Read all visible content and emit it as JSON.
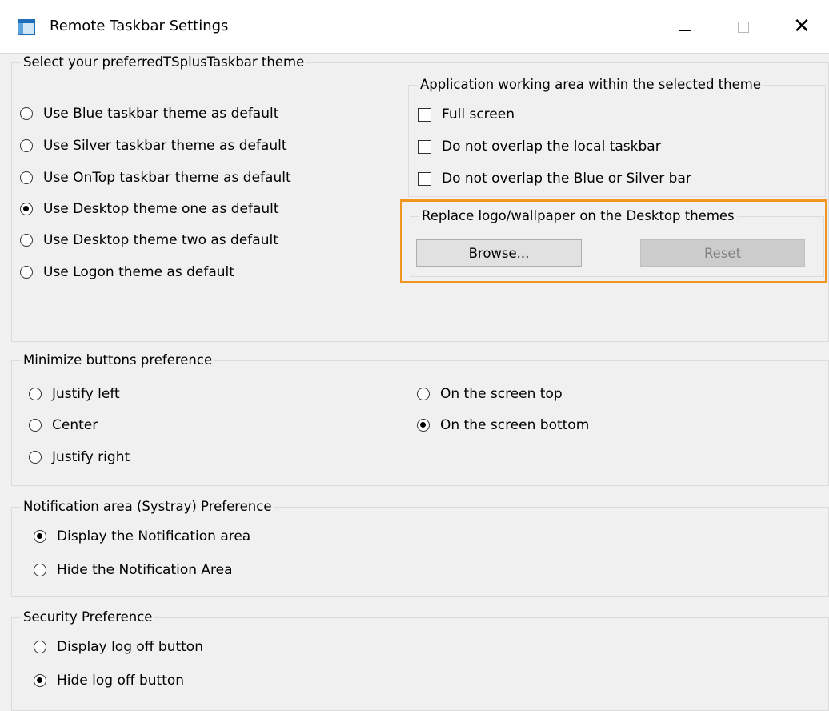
{
  "window": {
    "title": "Remote Taskbar Settings",
    "minimize_icon": "minimize-icon",
    "maximize_icon": "maximize-icon",
    "close_glyph": "✕"
  },
  "theme_group": {
    "legend": "Select your preferredTSplusTaskbar theme",
    "options": [
      {
        "label": "Use Blue taskbar theme as default",
        "checked": false
      },
      {
        "label": "Use Silver taskbar theme as default",
        "checked": false
      },
      {
        "label": "Use OnTop taskbar theme as default",
        "checked": false
      },
      {
        "label": "Use Desktop theme one as default",
        "checked": true
      },
      {
        "label": "Use Desktop theme two as default",
        "checked": false
      },
      {
        "label": "Use Logon theme as default",
        "checked": false
      }
    ]
  },
  "working_area": {
    "legend": "Application working area within the selected theme",
    "options": [
      {
        "label": "Full screen",
        "checked": false
      },
      {
        "label": "Do not overlap the local taskbar",
        "checked": false
      },
      {
        "label": "Do not overlap the Blue or Silver bar",
        "checked": false
      }
    ]
  },
  "replace_logo": {
    "legend": "Replace logo/wallpaper on the Desktop themes",
    "browse_label": "Browse...",
    "reset_label": "Reset",
    "reset_enabled": false,
    "highlight_color": "#f0961e"
  },
  "minimize_group": {
    "legend": "Minimize buttons preference",
    "justify_options": [
      {
        "label": "Justify left",
        "checked": false
      },
      {
        "label": "Center",
        "checked": false
      },
      {
        "label": "Justify right",
        "checked": false
      }
    ],
    "position_options": [
      {
        "label": "On the screen top",
        "checked": false
      },
      {
        "label": "On the screen bottom",
        "checked": true
      }
    ]
  },
  "notification_group": {
    "legend": "Notification area (Systray) Preference",
    "options": [
      {
        "label": "Display the Notification area",
        "checked": true
      },
      {
        "label": "Hide the Notification Area",
        "checked": false
      }
    ]
  },
  "security_group": {
    "legend": "Security Preference",
    "options": [
      {
        "label": "Display log off button",
        "checked": false
      },
      {
        "label": "Hide log off button",
        "checked": true
      }
    ]
  }
}
